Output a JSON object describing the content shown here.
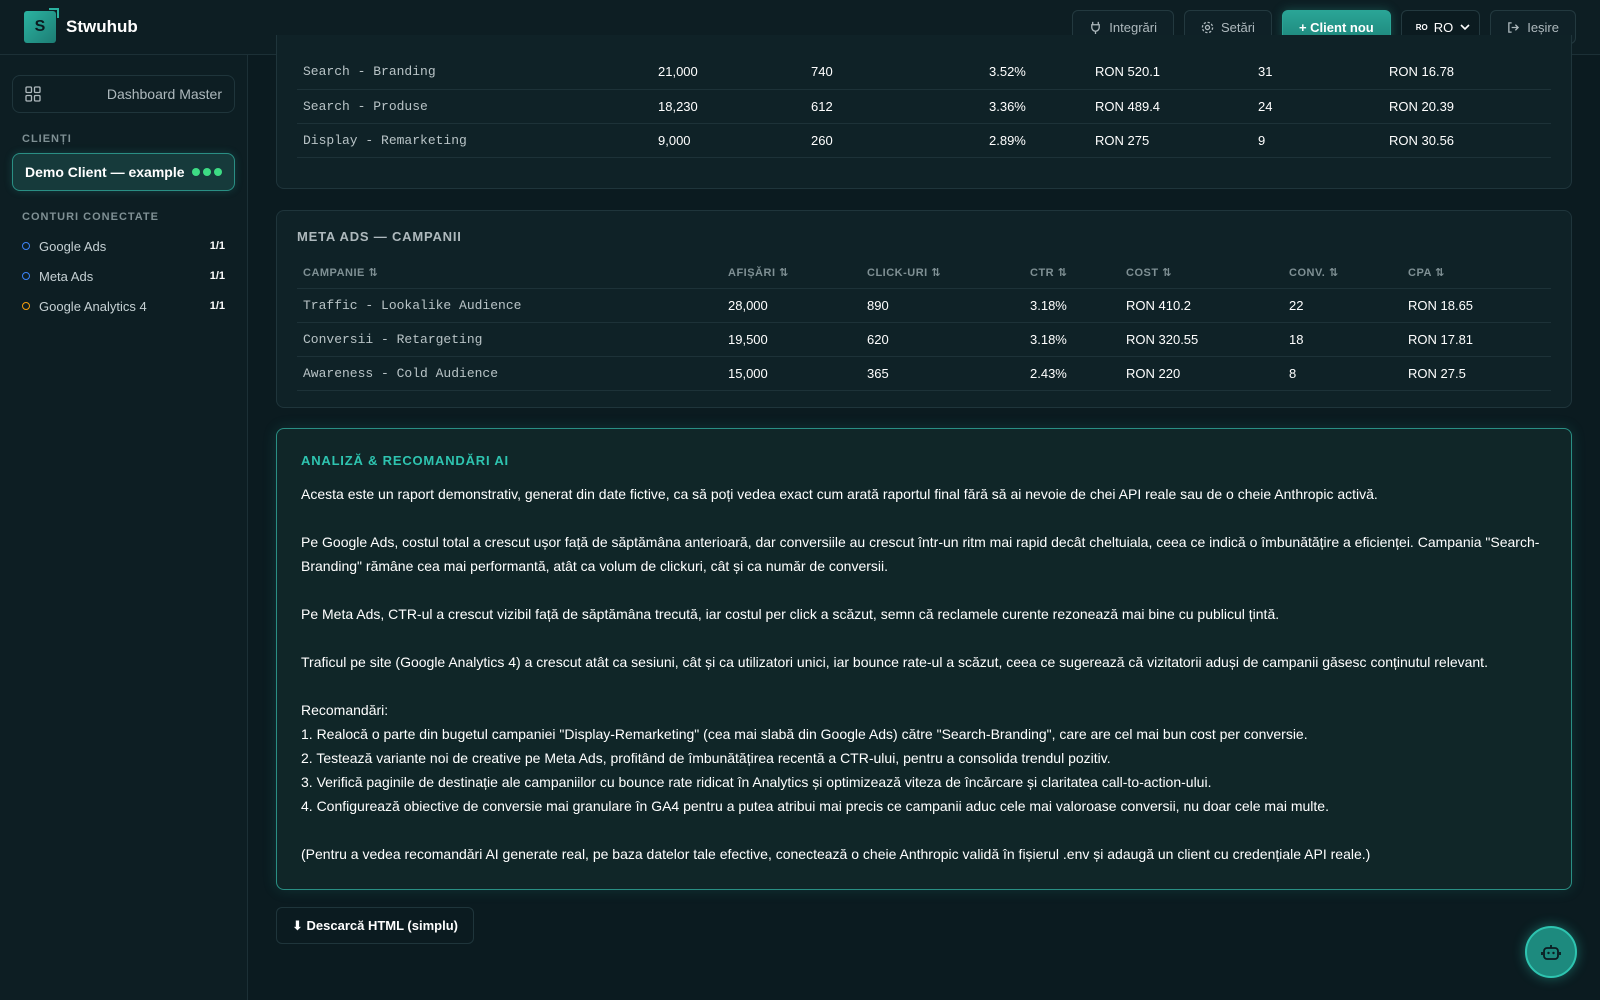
{
  "app": {
    "logo_letter": "S",
    "name": "Stwuhub"
  },
  "topbar": {
    "integrations": "Integrări",
    "settings": "Setări",
    "new_client": "+ Client nou",
    "lang_flag": "RO",
    "lang": "RO",
    "logout": "Ieșire"
  },
  "sidebar": {
    "dashboard": "Dashboard Master",
    "clients_title": "CLIENȚI",
    "client_name": "Demo Client — example",
    "accounts_title": "CONTURI CONECTATE",
    "accounts": [
      {
        "name": "Google Ads",
        "count": "1/1",
        "color": "#3b82f6"
      },
      {
        "name": "Meta Ads",
        "count": "1/1",
        "color": "#3b82f6"
      },
      {
        "name": "Google Analytics 4",
        "count": "1/1",
        "color": "#f59e0b"
      }
    ]
  },
  "google_table": {
    "rows": [
      {
        "campaign": "Search - Branding",
        "impressions": "21,000",
        "clicks": "740",
        "ctr": "3.52%",
        "cost": "RON 520.1",
        "conv": "31",
        "cpa": "RON 16.78"
      },
      {
        "campaign": "Search - Produse",
        "impressions": "18,230",
        "clicks": "612",
        "ctr": "3.36%",
        "cost": "RON 489.4",
        "conv": "24",
        "cpa": "RON 20.39"
      },
      {
        "campaign": "Display - Remarketing",
        "impressions": "9,000",
        "clicks": "260",
        "ctr": "2.89%",
        "cost": "RON 275",
        "conv": "9",
        "cpa": "RON 30.56"
      }
    ]
  },
  "meta_table": {
    "title": "META ADS — CAMPANII",
    "headers": [
      "CAMPANIE ⇅",
      "AFIȘĂRI ⇅",
      "CLICK-URI ⇅",
      "CTR ⇅",
      "COST ⇅",
      "CONV. ⇅",
      "CPA ⇅"
    ],
    "rows": [
      {
        "campaign": "Traffic - Lookalike Audience",
        "impressions": "28,000",
        "clicks": "890",
        "ctr": "3.18%",
        "cost": "RON 410.2",
        "conv": "22",
        "cpa": "RON 18.65"
      },
      {
        "campaign": "Conversii - Retargeting",
        "impressions": "19,500",
        "clicks": "620",
        "ctr": "3.18%",
        "cost": "RON 320.55",
        "conv": "18",
        "cpa": "RON 17.81"
      },
      {
        "campaign": "Awareness - Cold Audience",
        "impressions": "15,000",
        "clicks": "365",
        "ctr": "2.43%",
        "cost": "RON 220",
        "conv": "8",
        "cpa": "RON 27.5"
      }
    ]
  },
  "ai": {
    "title": "ANALIZĂ & RECOMANDĂRI AI",
    "p1": "Acesta este un raport demonstrativ, generat din date fictive, ca să poți vedea exact cum arată raportul final fără să ai nevoie de chei API reale sau de o cheie Anthropic activă.",
    "p2": "Pe Google Ads, costul total a crescut ușor față de săptămâna anterioară, dar conversiile au crescut într-un ritm mai rapid decât cheltuiala, ceea ce indică o îmbunătățire a eficienței. Campania \"Search-Branding\" rămâne cea mai performantă, atât ca volum de clickuri, cât și ca număr de conversii.",
    "p3": "Pe Meta Ads, CTR-ul a crescut vizibil față de săptămâna trecută, iar costul per click a scăzut, semn că reclamele curente rezonează mai bine cu publicul țintă.",
    "p4": "Traficul pe site (Google Analytics 4) a crescut atât ca sesiuni, cât și ca utilizatori unici, iar bounce rate-ul a scăzut, ceea ce sugerează că vizitatorii aduși de campanii găsesc conținutul relevant.",
    "rec_title": "Recomandări:",
    "rec1": "1. Realocă o parte din bugetul campaniei \"Display-Remarketing\" (cea mai slabă din Google Ads) către \"Search-Branding\", care are cel mai bun cost per conversie.",
    "rec2": "2. Testează variante noi de creative pe Meta Ads, profitând de îmbunătățirea recentă a CTR-ului, pentru a consolida trendul pozitiv.",
    "rec3": "3. Verifică paginile de destinație ale campaniilor cu bounce rate ridicat în Analytics și optimizează viteza de încărcare și claritatea call-to-action-ului.",
    "rec4": "4. Configurează obiective de conversie mai granulare în GA4 pentru a putea atribui mai precis ce campanii aduc cele mai valoroase conversii, nu doar cele mai multe.",
    "p5": "(Pentru a vedea recomandări AI generate real, pe baza datelor tale efective, conectează o cheie Anthropic validă în fișierul .env și adaugă un client cu credențiale API reale.)"
  },
  "download": "⬇ Descarcă HTML (simplu)"
}
